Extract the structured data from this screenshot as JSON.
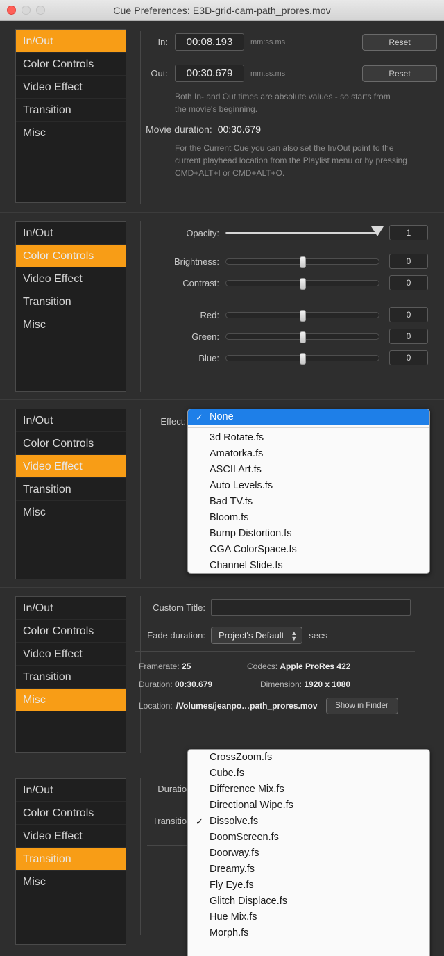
{
  "window": {
    "title": "Cue Preferences: E3D-grid-cam-path_prores.mov",
    "traffic": {
      "close": "close-button",
      "minimize": "minimize-button",
      "maximize": "maximize-button"
    },
    "accent_orange": "#f89d16",
    "background": "#2e2e2e"
  },
  "sidebar_items": [
    "In/Out",
    "Color Controls",
    "Video Effect",
    "Transition",
    "Misc"
  ],
  "sections": [
    {
      "id": "inout",
      "active_item": "In/Out"
    },
    {
      "id": "color",
      "active_item": "Color Controls"
    },
    {
      "id": "videoeffect",
      "active_item": "Video Effect"
    },
    {
      "id": "misc",
      "active_item": "Misc"
    },
    {
      "id": "transition",
      "active_item": "Transition"
    }
  ],
  "inout": {
    "in_label": "In:",
    "in_value": "00:08.193",
    "in_unit": "mm:ss.ms",
    "out_label": "Out:",
    "out_value": "00:30.679",
    "out_unit": "mm:ss.ms",
    "reset_label": "Reset",
    "hint1": "Both In- and Out times are absolute values - so starts from the movie's beginning.",
    "duration_label": "Movie duration:",
    "duration_value": "00:30.679",
    "hint2": "For the Current Cue you can also set the In/Out point to the current playhead location from the Playlist menu or by pressing CMD+ALT+I or CMD+ALT+O."
  },
  "color": {
    "sliders": [
      {
        "label": "Opacity:",
        "value": "1",
        "pos": 100,
        "type": "triangle"
      },
      {
        "label": "Brightness:",
        "value": "0",
        "pos": 50,
        "type": "knob"
      },
      {
        "label": "Contrast:",
        "value": "0",
        "pos": 50,
        "type": "knob"
      },
      {
        "label": "Red:",
        "value": "0",
        "pos": 50,
        "type": "knob"
      },
      {
        "label": "Green:",
        "value": "0",
        "pos": 50,
        "type": "knob"
      },
      {
        "label": "Blue:",
        "value": "0",
        "pos": 50,
        "type": "knob"
      }
    ]
  },
  "videoeffect": {
    "effect_label": "Effect:",
    "selected": "None",
    "menu_items": [
      "None",
      "3d Rotate.fs",
      "Amatorka.fs",
      "ASCII Art.fs",
      "Auto Levels.fs",
      "Bad TV.fs",
      "Bloom.fs",
      "Bump Distortion.fs",
      "CGA ColorSpace.fs",
      "Channel Slide.fs"
    ],
    "checkmark": "✓"
  },
  "misc": {
    "custom_title_label": "Custom Title:",
    "custom_title_value": "",
    "custom_title_placeholder": "",
    "fade_label": "Fade duration:",
    "fade_value": "Project's Default",
    "fade_unit": "secs",
    "framerate_label": "Framerate:",
    "framerate_value": "25",
    "codecs_label": "Codecs:",
    "codecs_value": "Apple ProRes 422",
    "duration_label": "Duration:",
    "duration_value": "00:30.679",
    "dimension_label": "Dimension:",
    "dimension_value": "1920 x 1080",
    "location_label": "Location:",
    "location_value": "/Volumes/jeanpo…path_prores.mov",
    "show_in_finder_label": "Show in Finder"
  },
  "transition": {
    "duration_label": "Duration:",
    "transition_label": "Transition:",
    "selected": "Dissolve.fs",
    "menu_items": [
      "CrossZoom.fs",
      "Cube.fs",
      "Difference Mix.fs",
      "Directional Wipe.fs",
      "Dissolve.fs",
      "DoomScreen.fs",
      "Doorway.fs",
      "Dreamy.fs",
      "Fly Eye.fs",
      "Glitch Displace.fs",
      "Hue Mix.fs",
      "Morph.fs"
    ],
    "checkmark": "✓"
  }
}
